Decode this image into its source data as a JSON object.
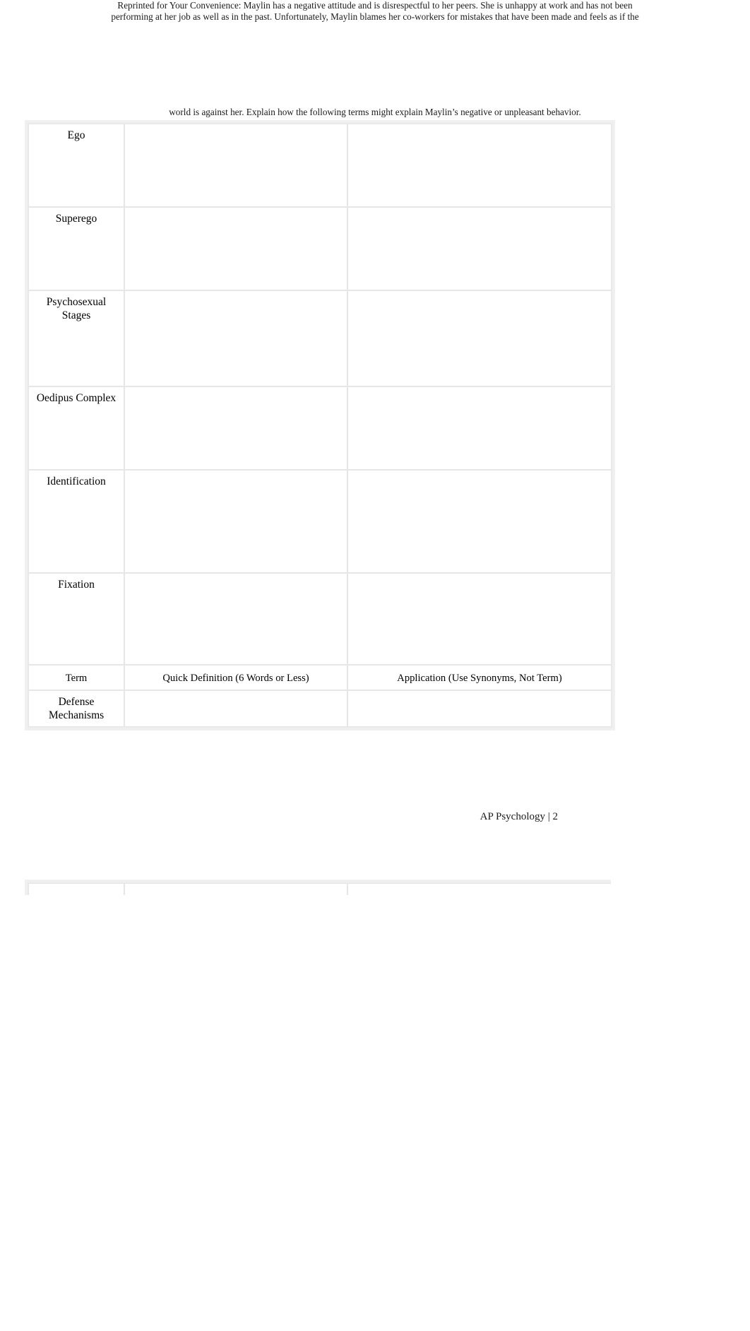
{
  "document": {
    "intro_lines": [
      "Reprinted for Your Convenience:   Maylin has a negative attitude and is disrespectful to her peers. She is unhappy at work and has not been",
      "performing at her job as well as in the past. Unfortunately, Maylin blames her co-workers for mistakes that have been made and feels as if the"
    ],
    "prompt_line": "world is against her. Explain how the following terms might explain Maylin’s negative or unpleasant behavior.",
    "footer": "AP Psychology | 2"
  },
  "table": {
    "columns": [
      {
        "key": "term",
        "header": "Term"
      },
      {
        "key": "definition",
        "header": "Quick Definition (6 Words or Less)"
      },
      {
        "key": "application",
        "header": "Application (Use Synonyms, Not Term)"
      }
    ],
    "rows": [
      {
        "term": "Ego",
        "definition": "",
        "application": ""
      },
      {
        "term": "Superego",
        "definition": "",
        "application": ""
      },
      {
        "term": "Psychosexual\nStages",
        "definition": "",
        "application": ""
      },
      {
        "term": "Oedipus Complex",
        "definition": "",
        "application": ""
      },
      {
        "term": "Identification",
        "definition": "",
        "application": ""
      },
      {
        "term": "Fixation",
        "definition": "",
        "application": ""
      }
    ],
    "header_row": {
      "term": "Term",
      "definition": "Quick Definition (6 Words or Less)",
      "application": "Application (Use Synonyms, Not Term)"
    },
    "trailing_rows": [
      {
        "term": "Defense\nMechanisms",
        "definition": "",
        "application": ""
      }
    ]
  },
  "colors": {
    "page_background": "#ffffff",
    "cell_background": "#ffffff",
    "gutter": "#ededed",
    "cell_border": "#e6e6e6",
    "text": "#1a1a1a"
  }
}
